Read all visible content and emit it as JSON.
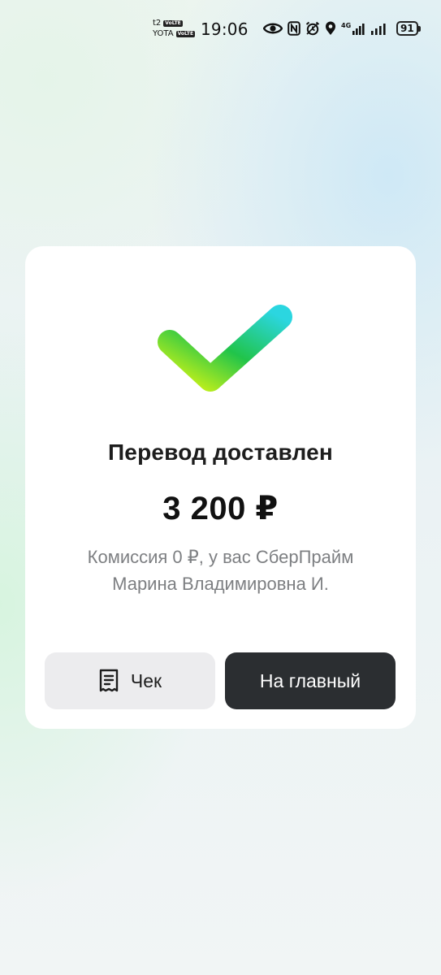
{
  "status_bar": {
    "carrier_1": "t2",
    "carrier_2": "YOTA",
    "volte_label": "VoLTE",
    "time": "19:06",
    "network": "4G",
    "battery": "91",
    "icons": [
      "eye-icon",
      "nfc-icon",
      "alarm-icon",
      "location-icon",
      "signal-icon"
    ]
  },
  "result": {
    "title": "Перевод доставлен",
    "amount": "3 200 ₽",
    "commission": "Комиссия 0 ₽, у вас СберПрайм",
    "recipient": "Марина Владимировна И.",
    "icon": "checkmark-icon"
  },
  "actions": {
    "receipt_label": "Чек",
    "receipt_icon": "receipt-icon",
    "home_label": "На главный"
  },
  "colors": {
    "check_gradient_start": "#d4f514",
    "check_gradient_mid": "#21c44a",
    "check_gradient_end": "#2bd6e0",
    "home_button": "#2b2e31",
    "receipt_button": "#ececee"
  }
}
